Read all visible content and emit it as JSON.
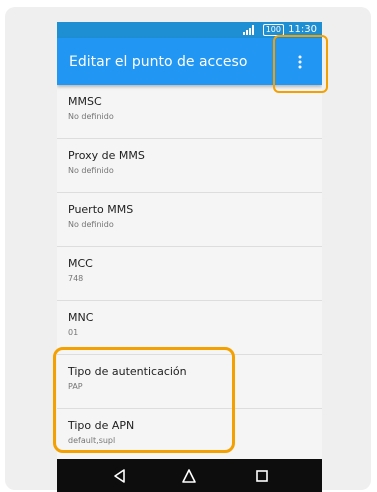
{
  "status_bar": {
    "battery": "100",
    "time": "11:30"
  },
  "app_bar": {
    "title": "Editar el punto de acceso",
    "menu_icon": "more-vert-icon"
  },
  "settings": [
    {
      "title": "MMSC",
      "value": "No definido"
    },
    {
      "title": "Proxy de MMS",
      "value": "No definido"
    },
    {
      "title": "Puerto MMS",
      "value": "No definido"
    },
    {
      "title": "MCC",
      "value": "748"
    },
    {
      "title": "MNC",
      "value": "01"
    },
    {
      "title": "Tipo de autenticación",
      "value": "PAP"
    },
    {
      "title": "Tipo de APN",
      "value": "default,supl"
    }
  ],
  "nav_bar": {
    "back_icon": "back-icon",
    "home_icon": "home-icon",
    "recents_icon": "recents-icon"
  },
  "colors": {
    "app_bar": "#2196f3",
    "status_bar": "#1f8fd4",
    "highlight": "#f4a000",
    "nav_bar": "#0d0d0d"
  }
}
